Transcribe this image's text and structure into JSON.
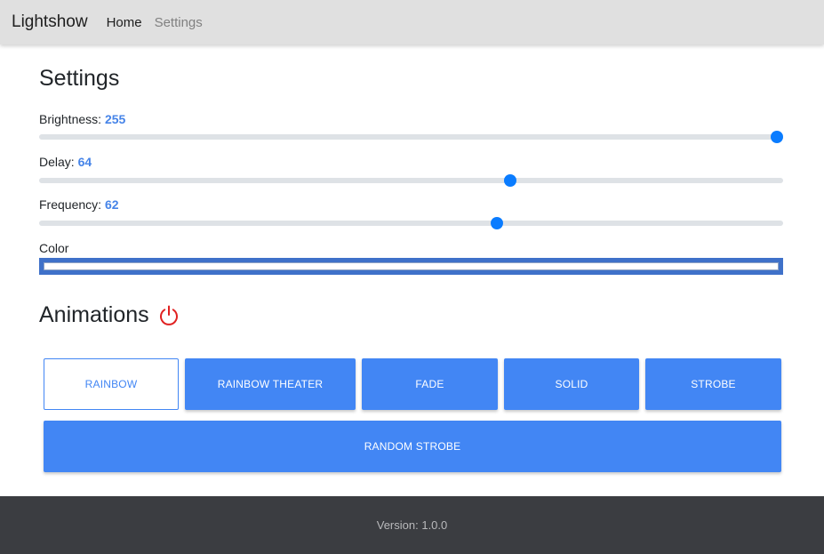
{
  "navbar": {
    "brand": "Lightshow",
    "links": [
      {
        "label": "Home",
        "active": true
      },
      {
        "label": "Settings",
        "active": false
      }
    ]
  },
  "settings": {
    "title": "Settings",
    "brightness": {
      "label": "Brightness: ",
      "value": "255",
      "fraction": 1.0
    },
    "delay": {
      "label": "Delay: ",
      "value": "64",
      "fraction": 0.636
    },
    "frequency": {
      "label": "Frequency: ",
      "value": "62",
      "fraction": 0.617
    },
    "color": {
      "label": "Color",
      "value": "#ffffff"
    }
  },
  "animations": {
    "title": "Animations",
    "power_icon": "power-icon",
    "power_color": "#e02020",
    "buttons": [
      "RAINBOW",
      "RAINBOW THEATER",
      "FADE",
      "SOLID",
      "STROBE",
      "RANDOM STROBE"
    ],
    "selected": "RAINBOW"
  },
  "footer": {
    "version": "Version: 1.0.0"
  },
  "colors": {
    "accent": "#4286f4",
    "slider_thumb": "#0a7cff",
    "footer_bg": "#3b3d41"
  }
}
